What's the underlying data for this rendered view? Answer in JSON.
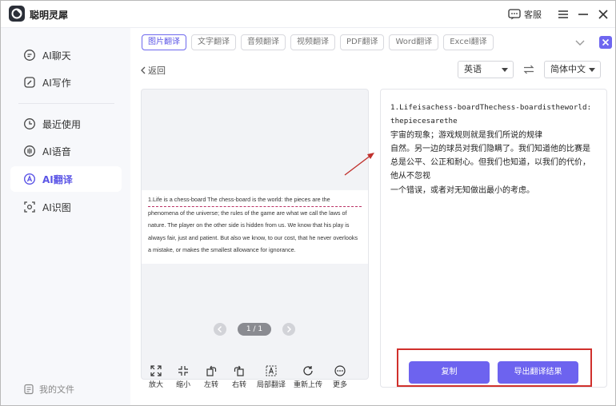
{
  "app": {
    "name": "聪明灵犀",
    "service_label": "客服"
  },
  "sidebar": {
    "items": [
      {
        "label": "AI聊天",
        "icon": "chat-icon"
      },
      {
        "label": "AI写作",
        "icon": "write-icon"
      },
      {
        "label": "最近使用",
        "icon": "clock-icon"
      },
      {
        "label": "AI语音",
        "icon": "voice-icon"
      },
      {
        "label": "AI翻译",
        "icon": "translate-icon",
        "active": true
      },
      {
        "label": "AI识图",
        "icon": "scan-icon"
      }
    ],
    "my_files": "我的文件"
  },
  "tabs": [
    "图片翻译",
    "文字翻译",
    "音频翻译",
    "视频翻译",
    "PDF翻译",
    "Word翻译",
    "Excel翻译"
  ],
  "active_tab": "图片翻译",
  "back_label": "返回",
  "source_lang": "英语",
  "target_lang": "简体中文",
  "preview": {
    "doc_lines": [
      "1.Life is a chess-board The chess-board is the world: the pieces are the",
      "phenomena of the universe; the rules of the game are what we call the laws of",
      "nature. The player on the other side is hidden from us. We know that his play is",
      "always fair, just and patient. But also we know, to our cost, that he never overlooks",
      "a mistake, or makes the smallest allowance for ignorance."
    ],
    "page_indicator": "1 / 1"
  },
  "toolbar": {
    "zoom_in": "放大",
    "zoom_out": "缩小",
    "rotate_left": "左转",
    "rotate_right": "右转",
    "partial_translate": "局部翻译",
    "reupload": "重新上传",
    "more": "更多"
  },
  "result": {
    "lines": [
      "1.Lifeisachess-boardThechess-boardistheworld:",
      "thepiecesarethe",
      "宇宙的现象；游戏规则就是我们所说的规律",
      "自然。另一边的球员对我们隐瞒了。我们知道他的比赛是",
      "总是公平、公正和耐心。但我们也知道，以我们的代价，",
      "他从不忽视",
      "一个错误，或者对无知做出最小的考虑。"
    ],
    "copy_label": "复制",
    "export_label": "导出翻译结果"
  },
  "colors": {
    "accent": "#6d63ef",
    "highlight_box": "#d0302c",
    "arrow": "#c0302c"
  }
}
